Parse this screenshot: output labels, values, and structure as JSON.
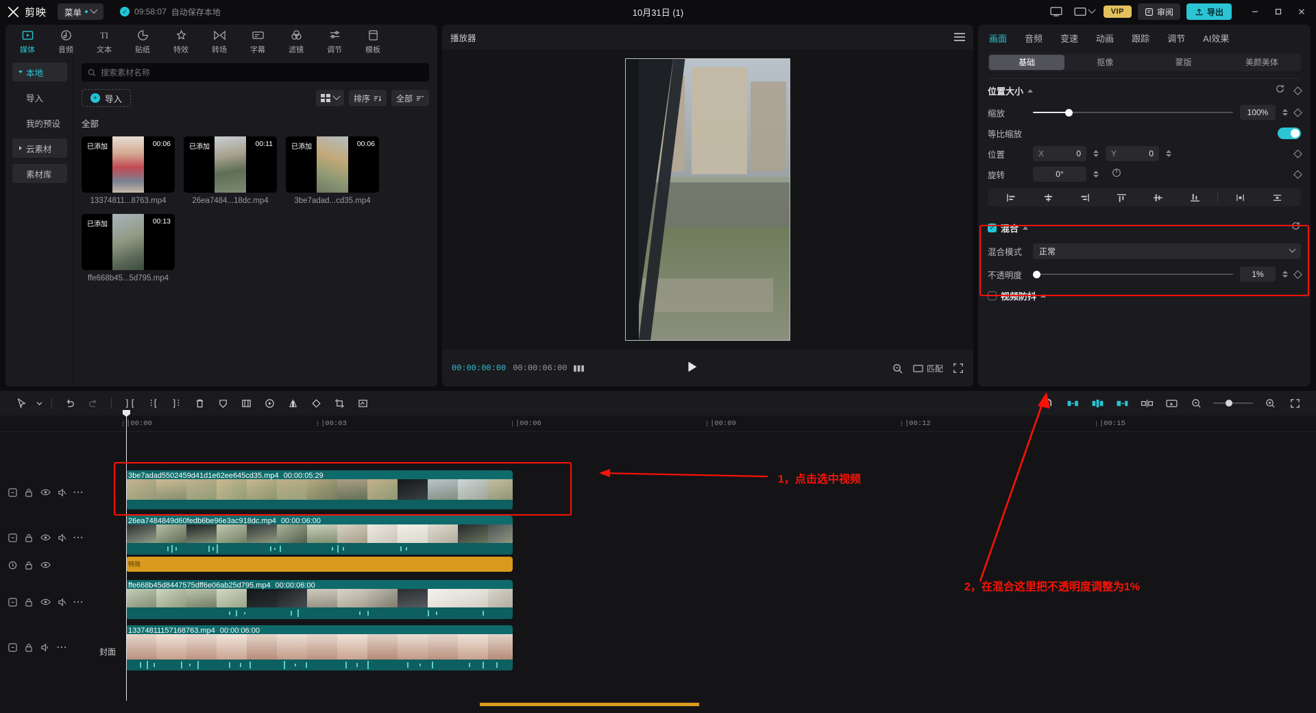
{
  "titlebar": {
    "app_name": "剪映",
    "menu_label": "菜单",
    "autosave_time": "09:58:07",
    "autosave_text": "自动保存本地",
    "project_title": "10月31日 (1)",
    "ratio_label": "",
    "vip_label": "VIP",
    "feedback_label": "审阅",
    "export_label": "导出",
    "min_label": "—",
    "max_label": "▢",
    "close_label": "✕"
  },
  "media": {
    "category_tabs": [
      {
        "label": "媒体",
        "icon": "media-icon",
        "active": true
      },
      {
        "label": "音频",
        "icon": "audio-icon",
        "active": false
      },
      {
        "label": "文本",
        "icon": "text-icon",
        "active": false
      },
      {
        "label": "贴纸",
        "icon": "sticker-icon",
        "active": false
      },
      {
        "label": "特效",
        "icon": "effects-icon",
        "active": false
      },
      {
        "label": "转场",
        "icon": "transition-icon",
        "active": false
      },
      {
        "label": "字幕",
        "icon": "subtitle-icon",
        "active": false
      },
      {
        "label": "滤镜",
        "icon": "filter-icon",
        "active": false
      },
      {
        "label": "调节",
        "icon": "adjust-icon",
        "active": false
      },
      {
        "label": "模板",
        "icon": "template-icon",
        "active": false
      }
    ],
    "sub_nav": [
      {
        "label": "本地",
        "active": true,
        "caret": "down"
      },
      {
        "label": "导入",
        "active": false,
        "caret": ""
      },
      {
        "label": "我的预设",
        "active": false,
        "caret": ""
      },
      {
        "label": "云素材",
        "active": false,
        "caret": "right",
        "boxed": true
      },
      {
        "label": "素材库",
        "active": false,
        "caret": "",
        "boxed": true
      }
    ],
    "search_placeholder": "搜索素材名称",
    "search_value": "",
    "import_label": "导入",
    "sort_label": "排序",
    "filter_label": "全部",
    "section_label": "全部",
    "added_badge": "已添加",
    "items": [
      {
        "name": "13374811...8763.mp4",
        "duration": "00:06",
        "added": "已添加",
        "tone": "#d6b39c"
      },
      {
        "name": "26ea7484...18dc.mp4",
        "duration": "00:11",
        "added": "已添加",
        "tone": "#8a9aa6"
      },
      {
        "name": "3be7adad...cd35.mp4",
        "duration": "00:06",
        "added": "已添加",
        "tone": "#b0a184"
      },
      {
        "name": "ffe668b45...5d795.mp4",
        "duration": "00:13",
        "added": "已添加",
        "tone": "#9aa9a0"
      }
    ]
  },
  "player": {
    "title": "播放器",
    "current_time": "00:00:00:00",
    "total_time": "00:00:06:00",
    "fit_label": "匹配",
    "play_icon": "play-icon"
  },
  "properties": {
    "tabs": [
      {
        "label": "画面",
        "active": true
      },
      {
        "label": "音频",
        "active": false
      },
      {
        "label": "变速",
        "active": false
      },
      {
        "label": "动画",
        "active": false
      },
      {
        "label": "跟踪",
        "active": false
      },
      {
        "label": "调节",
        "active": false
      },
      {
        "label": "AI效果",
        "active": false
      }
    ],
    "segments": [
      {
        "label": "基础",
        "on": true
      },
      {
        "label": "抠像",
        "on": false
      },
      {
        "label": "蒙版",
        "on": false
      },
      {
        "label": "美颜美体",
        "on": false
      }
    ],
    "position_size": {
      "title": "位置大小",
      "scale_label": "缩放",
      "scale_value": "100%",
      "scale_percent": 18,
      "uniform_label": "等比缩放",
      "uniform_on": true,
      "position_label": "位置",
      "pos_x_axis": "X",
      "pos_x_value": "0",
      "pos_y_axis": "Y",
      "pos_y_value": "0",
      "rotate_label": "旋转",
      "rotate_value": "0°"
    },
    "blend": {
      "title": "混合",
      "checked": true,
      "mode_label": "混合模式",
      "mode_value": "正常",
      "opacity_label": "不透明度",
      "opacity_value": "1%",
      "opacity_percent": 1
    },
    "stabilize": {
      "title": "视频防抖",
      "checked": false
    }
  },
  "timeline": {
    "ruler_ticks": [
      "|00:00",
      "|00:03",
      "|00:06",
      "|00:09",
      "|00:12",
      "|00:15"
    ],
    "clips": [
      {
        "name": "3be7adad5502459d41d1e62ee645cd35.mp4",
        "duration": "00:00:05:29",
        "selected": true
      },
      {
        "name": "26ea7484849d60fedb6be96e3ac918dc.mp4",
        "duration": "00:00:06:00",
        "selected": false
      },
      {
        "name": "ffe668b45d8447575dff6e06ab25d795.mp4",
        "duration": "00:00:06:00",
        "selected": false
      },
      {
        "name": "13374811157168763.mp4",
        "duration": "00:00:06:00",
        "selected": false
      }
    ],
    "effect_clip_label": "特效",
    "cover_label": "封面"
  },
  "annotations": [
    {
      "text": "1，点击选中视频",
      "color": "#fb1205"
    },
    {
      "text": "2，在混合这里把不透明度调整为1%",
      "color": "#fb1205"
    }
  ],
  "colors": {
    "accent": "#2bc4d4",
    "annotation": "#fb1205",
    "clip_teal": "#0f6b6b",
    "effect_orange": "#d99a1e",
    "vip_gold": "#e2c15d"
  }
}
